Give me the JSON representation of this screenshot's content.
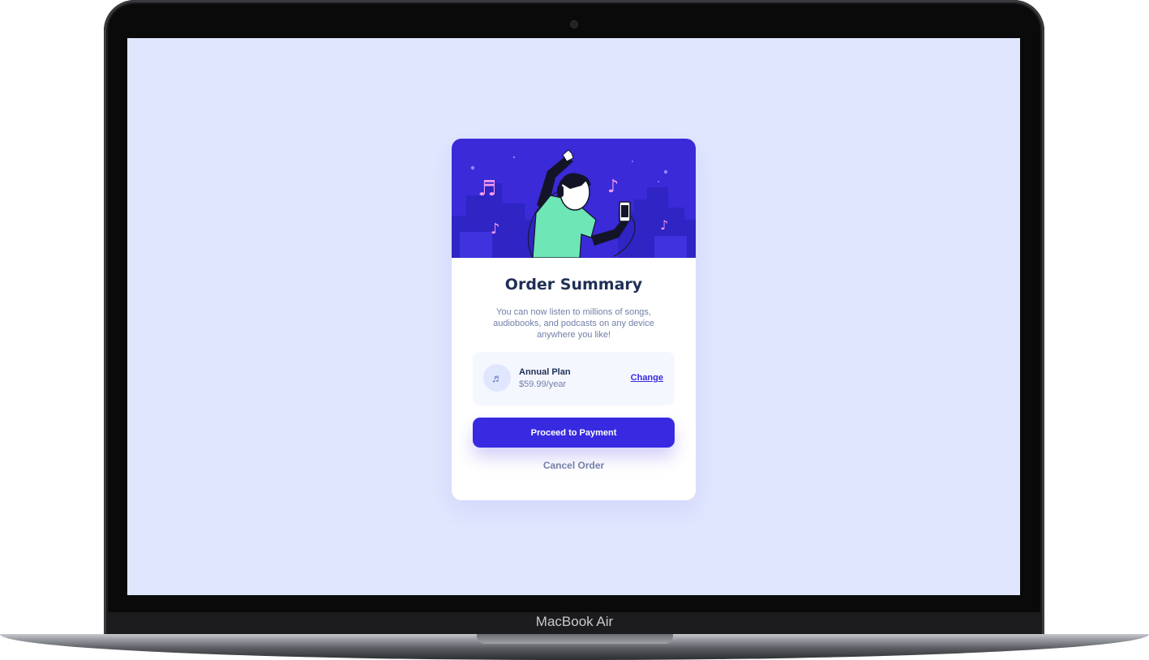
{
  "device": {
    "brand_label": "MacBook Air"
  },
  "card": {
    "title": "Order Summary",
    "description": "You can now listen to millions of songs, audiobooks, and podcasts on any device anywhere you like!",
    "plan": {
      "icon": "music-note-icon",
      "name": "Annual Plan",
      "price": "$59.99/year",
      "change_label": "Change"
    },
    "proceed_label": "Proceed to Payment",
    "cancel_label": "Cancel Order"
  },
  "colors": {
    "page_background": "#e0e6fd",
    "hero_background": "#3a2ad8",
    "primary": "#382ae1",
    "title_text": "#1f2f56",
    "body_text": "#717fa6",
    "plan_background": "#f5f7ff",
    "illustration_accent": "#6ee6b6"
  }
}
